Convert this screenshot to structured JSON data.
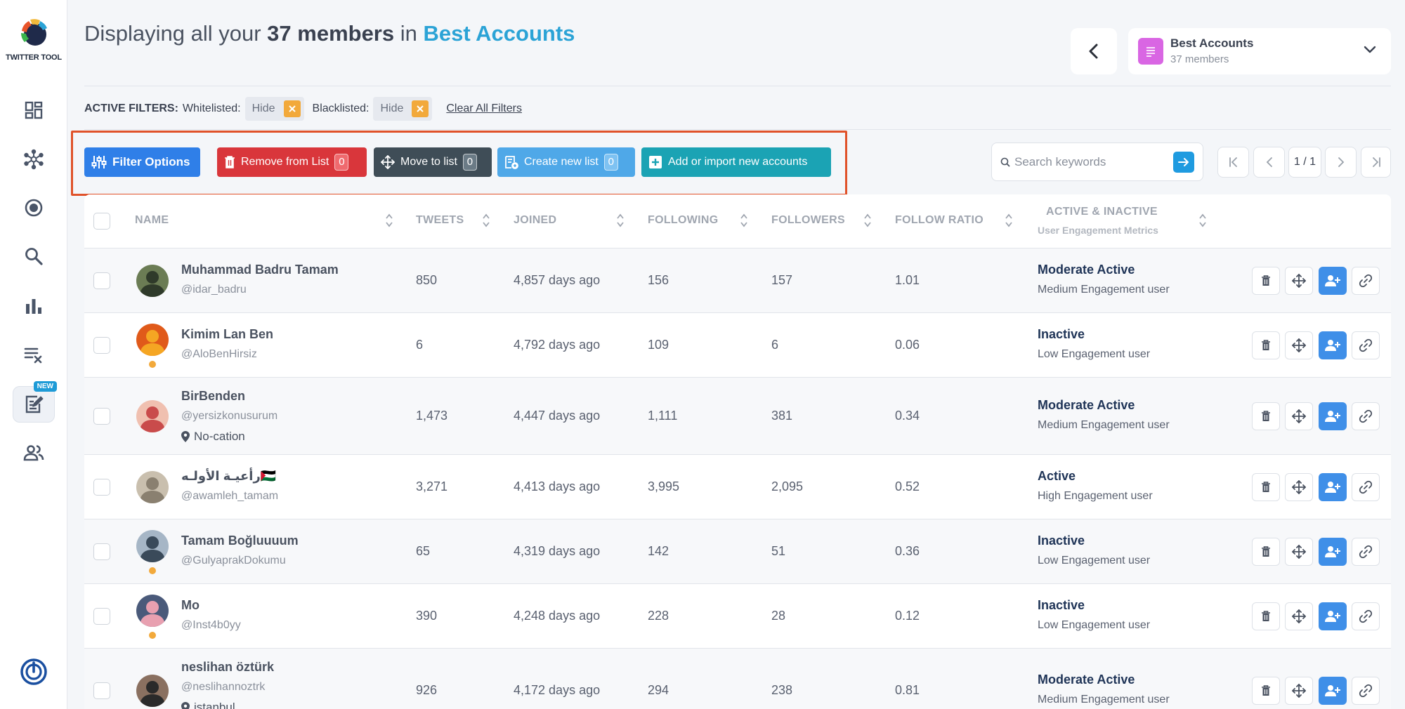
{
  "app": {
    "logo_text": "TWITTER TOOL",
    "new_badge": "NEW"
  },
  "sidebar": {
    "items": [
      {
        "name": "dashboard-icon"
      },
      {
        "name": "network-icon"
      },
      {
        "name": "target-icon"
      },
      {
        "name": "search-icon"
      },
      {
        "name": "bar-chart-icon"
      },
      {
        "name": "clear-list-icon"
      },
      {
        "name": "edit-list-icon",
        "active": true
      },
      {
        "name": "users-icon"
      }
    ]
  },
  "header": {
    "title_prefix": "Displaying all your ",
    "title_count": "37 members",
    "title_mid": " in ",
    "title_list": "Best Accounts"
  },
  "list_selector": {
    "name": "Best Accounts",
    "count": "37 members"
  },
  "filters": {
    "label": "ACTIVE FILTERS:",
    "whitelisted_label": "Whitelisted:",
    "whitelisted_value": "Hide",
    "blacklisted_label": "Blacklisted:",
    "blacklisted_value": "Hide",
    "clear": "Clear All Filters"
  },
  "actions": {
    "filter": "Filter Options",
    "remove": "Remove from List",
    "remove_count": "0",
    "move": "Move to list",
    "move_count": "0",
    "create": "Create new list",
    "create_count": "0",
    "add": "Add or import new accounts"
  },
  "search": {
    "placeholder": "Search keywords"
  },
  "pagination": {
    "page": "1 / 1"
  },
  "table": {
    "columns": {
      "name": "NAME",
      "tweets": "TWEETS",
      "joined": "JOINED",
      "following": "FOLLOWING",
      "followers": "FOLLOWERS",
      "ratio": "FOLLOW RATIO",
      "activity": "ACTIVE & INACTIVE",
      "activity_sub": "User Engagement Metrics"
    },
    "rows": [
      {
        "name": "Muhammad Badru Tamam",
        "handle": "@idar_badru",
        "location": "",
        "tweets": "850",
        "joined": "4,857 days ago",
        "following": "156",
        "followers": "157",
        "ratio": "1.01",
        "status": "Moderate Active",
        "engagement": "Medium Engagement user"
      },
      {
        "name": "Kimim Lan Ben",
        "handle": "@AloBenHirsiz",
        "location": "",
        "tweets": "6",
        "joined": "4,792 days ago",
        "following": "109",
        "followers": "6",
        "ratio": "0.06",
        "status": "Inactive",
        "engagement": "Low Engagement user"
      },
      {
        "name": "BirBenden",
        "handle": "@yersizkonusurum",
        "location": "No-cation",
        "tweets": "1,473",
        "joined": "4,447 days ago",
        "following": "1,111",
        "followers": "381",
        "ratio": "0.34",
        "status": "Moderate Active",
        "engagement": "Medium Engagement user"
      },
      {
        "name": "رأعيـة الأولـه🇵🇸",
        "handle": "@awamleh_tamam",
        "location": "",
        "tweets": "3,271",
        "joined": "4,413 days ago",
        "following": "3,995",
        "followers": "2,095",
        "ratio": "0.52",
        "status": "Active",
        "engagement": "High Engagement user"
      },
      {
        "name": "Tamam Boğluuuum",
        "handle": "@GulyaprakDokumu",
        "location": "",
        "tweets": "65",
        "joined": "4,319 days ago",
        "following": "142",
        "followers": "51",
        "ratio": "0.36",
        "status": "Inactive",
        "engagement": "Low Engagement user"
      },
      {
        "name": "Mo",
        "handle": "@Inst4b0yy",
        "location": "",
        "tweets": "390",
        "joined": "4,248 days ago",
        "following": "228",
        "followers": "28",
        "ratio": "0.12",
        "status": "Inactive",
        "engagement": "Low Engagement user"
      },
      {
        "name": "neslihan öztürk",
        "handle": "@neslihannoztrk",
        "location": "istanbul",
        "tweets": "926",
        "joined": "4,172 days ago",
        "following": "294",
        "followers": "238",
        "ratio": "0.81",
        "status": "Moderate Active",
        "engagement": "Medium Engagement user"
      }
    ]
  },
  "colors": {
    "accent": "#2ba3d6",
    "primary_button": "#2f7fe8",
    "danger": "#d9363b",
    "dark": "#3f4d57",
    "info": "#4fa8e8",
    "teal": "#1ba3b4",
    "highlight_box": "#e0522a",
    "status_dot": "#f2a93b"
  }
}
